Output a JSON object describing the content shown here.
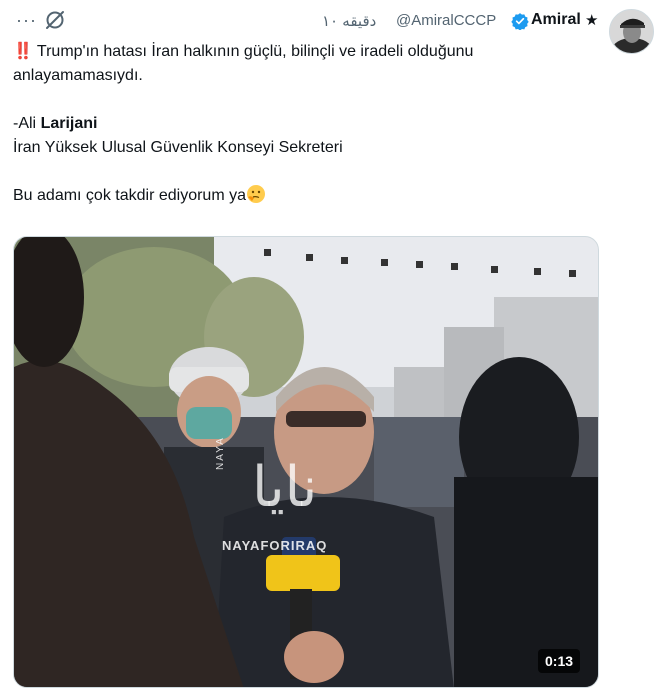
{
  "tweet": {
    "author_name": "Amiral",
    "author_badge": "★",
    "handle": "@AmiralCCCP",
    "time": "دقیقه ۱۰",
    "more_label": "···",
    "lines": [
      "Trump'ın hatası İran halkının güçlü, bilinçli ve iradeli olduğunu anlayamamasıydı.",
      "-Ali ",
      "Larijani",
      "İran Yüksek Ulusal Güvenlik Konseyi Sekreteri",
      "Bu adamı çok takdir ediyorum ya"
    ],
    "excl": "‼️"
  },
  "video": {
    "duration": "0:13",
    "watermark_ar": "نايا",
    "watermark_en": "NAYAFORIRAQ",
    "watermark_vertical": "NAYA"
  },
  "colors": {
    "text": "#0f1419",
    "muted": "#536471",
    "verified": "#1d9bf0"
  },
  "icons": [
    "more-icon",
    "grok-icon",
    "verified-badge-icon",
    "avatar",
    "thinking-emoji-icon"
  ]
}
